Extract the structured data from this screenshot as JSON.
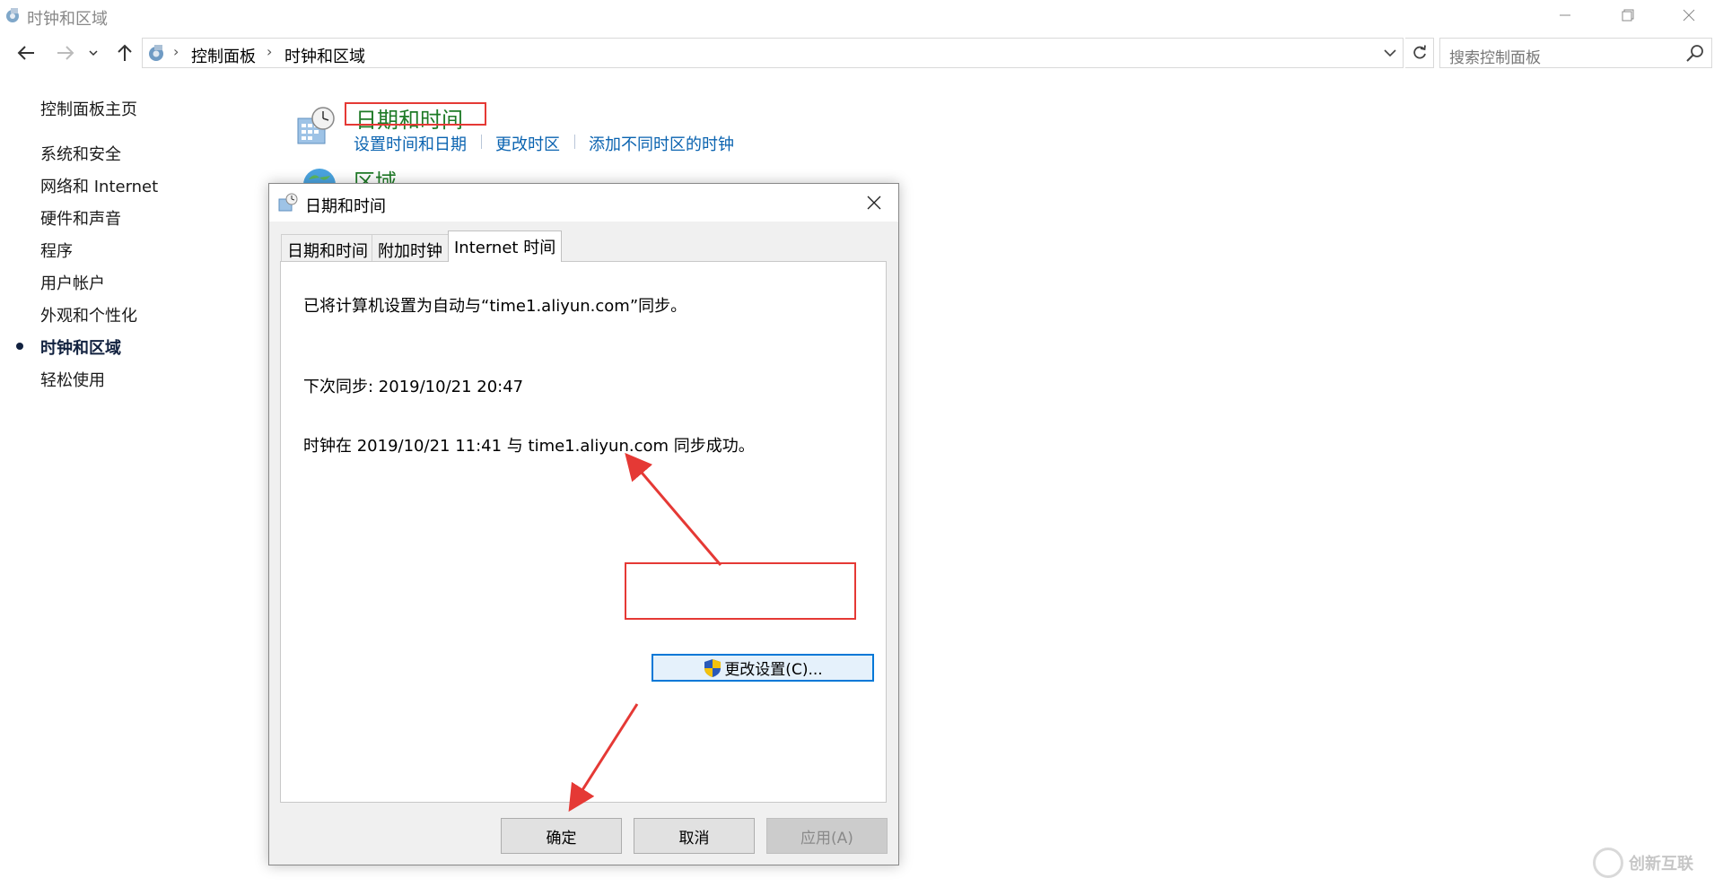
{
  "window": {
    "title": "时钟和区域",
    "min_icon": "minimize-icon",
    "max_icon": "restore-icon",
    "close_icon": "close-icon"
  },
  "nav": {
    "back_icon": "back-arrow-icon",
    "forward_icon": "forward-arrow-icon",
    "recent_icon": "chevron-down-icon",
    "up_icon": "up-arrow-icon",
    "breadcrumbs": [
      "控制面板",
      "时钟和区域"
    ],
    "refresh_icon": "refresh-icon",
    "search_placeholder": "搜索控制面板"
  },
  "sidebar": {
    "home": "控制面板主页",
    "items": [
      {
        "label": "系统和安全"
      },
      {
        "label": "网络和 Internet"
      },
      {
        "label": "硬件和声音"
      },
      {
        "label": "程序"
      },
      {
        "label": "用户帐户"
      },
      {
        "label": "外观和个性化"
      },
      {
        "label": "时钟和区域",
        "active": true
      },
      {
        "label": "轻松使用"
      }
    ]
  },
  "main": {
    "datetime": {
      "title": "日期和时间",
      "links": [
        "设置时间和日期",
        "更改时区",
        "添加不同时区的时钟"
      ]
    },
    "region": {
      "title": "区域"
    }
  },
  "dialog": {
    "title": "日期和时间",
    "tabs": [
      "日期和时间",
      "附加时钟",
      "Internet 时间"
    ],
    "active_tab": 2,
    "sync_line": "已将计算机设置为自动与“time1.aliyun.com”同步。",
    "next_sync": "下次同步: 2019/10/21 20:47",
    "result_line": "时钟在 2019/10/21 11:41 与 time1.aliyun.com 同步成功。",
    "change_button": "更改设置(C)...",
    "ok": "确定",
    "cancel": "取消",
    "apply": "应用(A)"
  },
  "annotations": {
    "color": "#e53935"
  },
  "watermark": {
    "brand": "创新互联"
  }
}
